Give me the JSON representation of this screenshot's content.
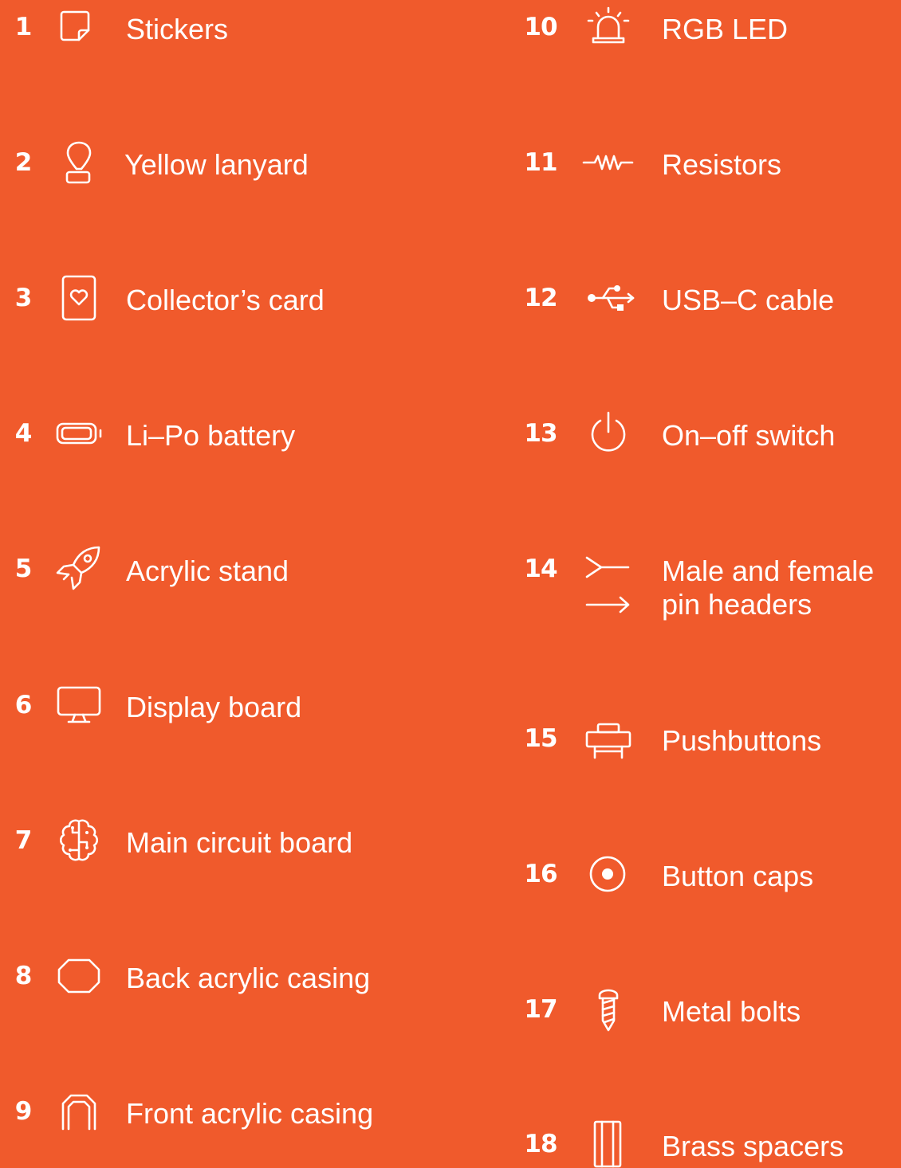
{
  "left_items": [
    {
      "number": "1",
      "label": "Stickers",
      "icon": "sticker-icon"
    },
    {
      "number": "2",
      "label": "Yellow lanyard",
      "icon": "lanyard-icon"
    },
    {
      "number": "3",
      "label": "Collector’s card",
      "icon": "heart-card-icon"
    },
    {
      "number": "4",
      "label": "Li–Po battery",
      "icon": "battery-icon"
    },
    {
      "number": "5",
      "label": "Acrylic stand",
      "icon": "rocket-icon"
    },
    {
      "number": "6",
      "label": "Display board",
      "icon": "monitor-icon"
    },
    {
      "number": "7",
      "label": "Main circuit board",
      "icon": "brain-circuit-icon"
    },
    {
      "number": "8",
      "label": "Back acrylic casing",
      "icon": "casing-back-icon"
    },
    {
      "number": "9",
      "label": "Front acrylic casing",
      "icon": "casing-front-icon"
    }
  ],
  "right_items": [
    {
      "number": "10",
      "label": "RGB LED",
      "icon": "siren-light-icon"
    },
    {
      "number": "11",
      "label": "Resistors",
      "icon": "resistor-icon"
    },
    {
      "number": "12",
      "label": "USB–C cable",
      "icon": "usb-icon"
    },
    {
      "number": "13",
      "label": "On–off switch",
      "icon": "power-icon"
    },
    {
      "number": "14",
      "label": "Male and female",
      "label_line2": "pin headers",
      "icon": "pin-headers-icon"
    },
    {
      "number": "15",
      "label": "Pushbuttons",
      "icon": "pushbutton-icon"
    },
    {
      "number": "16",
      "label": "Button caps",
      "icon": "button-cap-icon"
    },
    {
      "number": "17",
      "label": "Metal bolts",
      "icon": "bolt-icon"
    },
    {
      "number": "18",
      "label": "Brass spacers",
      "icon": "spacer-icon"
    }
  ],
  "colors": {
    "background": "#f05a2c",
    "foreground": "#ffffff"
  }
}
